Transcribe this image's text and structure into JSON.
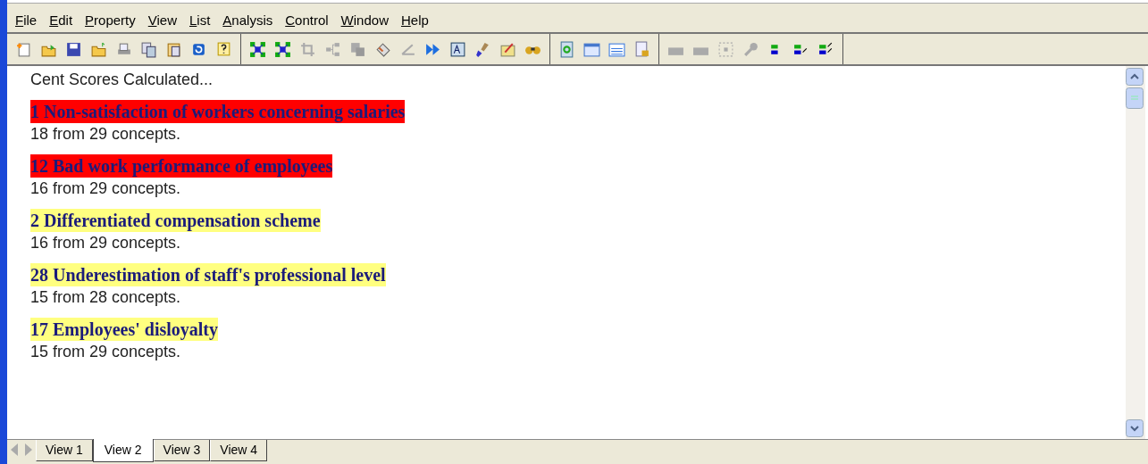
{
  "menu": [
    "File",
    "Edit",
    "Property",
    "View",
    "List",
    "Analysis",
    "Control",
    "Window",
    "Help"
  ],
  "content": {
    "heading": "Cent Scores Calculated...",
    "results": [
      {
        "title": "1 Non-satisfaction of workers concerning salaries",
        "color": "#ff0000",
        "count": "18 from 29 concepts."
      },
      {
        "title": "12 Bad work performance of employees",
        "color": "#ff0000",
        "count": "16 from 29 concepts."
      },
      {
        "title": "2 Differentiated compensation scheme",
        "color": "#ffff80",
        "count": "16 from 29 concepts."
      },
      {
        "title": "28 Underestimation of staff's professional level",
        "color": "#ffff80",
        "count": "15 from 28 concepts."
      },
      {
        "title": "17 Employees' disloyalty",
        "color": "#ffff80",
        "count": "15 from 29 concepts."
      }
    ]
  },
  "tabs": [
    {
      "label": "View 1",
      "selected": false
    },
    {
      "label": "View 2",
      "selected": true
    },
    {
      "label": "View 3",
      "selected": false
    },
    {
      "label": "View 4",
      "selected": false
    }
  ]
}
